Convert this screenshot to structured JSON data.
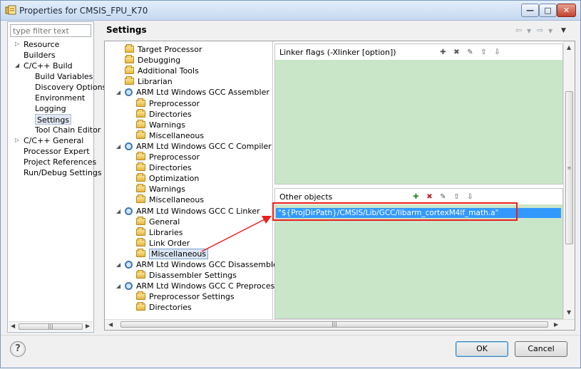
{
  "window": {
    "title": "Properties for CMSIS_FPU_K70"
  },
  "filter": {
    "placeholder": "type filter text"
  },
  "nav": [
    {
      "label": "Resource",
      "expandable": true
    },
    {
      "label": "Builders"
    },
    {
      "label": "C/C++ Build",
      "expanded": true
    },
    {
      "label": "Build Variables"
    },
    {
      "label": "Discovery Options"
    },
    {
      "label": "Environment"
    },
    {
      "label": "Logging"
    },
    {
      "label": "Settings",
      "selected": true
    },
    {
      "label": "Tool Chain Editor"
    },
    {
      "label": "C/C++ General",
      "expandable": true
    },
    {
      "label": "Processor Expert"
    },
    {
      "label": "Project References"
    },
    {
      "label": "Run/Debug Settings"
    }
  ],
  "settings": {
    "title": "Settings"
  },
  "tree": [
    {
      "label": "Target Processor",
      "icon": "folder-icon"
    },
    {
      "label": "Debugging",
      "icon": "folder-icon"
    },
    {
      "label": "Additional Tools",
      "icon": "folder-icon"
    },
    {
      "label": "Librarian",
      "icon": "folder-icon"
    },
    {
      "label": "ARM Ltd Windows GCC Assembler",
      "icon": "gear-icon"
    },
    {
      "label": "Preprocessor",
      "icon": "folder-icon"
    },
    {
      "label": "Directories",
      "icon": "folder-icon"
    },
    {
      "label": "Warnings",
      "icon": "folder-icon"
    },
    {
      "label": "Miscellaneous",
      "icon": "folder-icon"
    },
    {
      "label": "ARM Ltd Windows GCC C Compiler",
      "icon": "gear-icon"
    },
    {
      "label": "Preprocessor",
      "icon": "folder-icon"
    },
    {
      "label": "Directories",
      "icon": "folder-icon"
    },
    {
      "label": "Optimization",
      "icon": "folder-icon"
    },
    {
      "label": "Warnings",
      "icon": "folder-icon"
    },
    {
      "label": "Miscellaneous",
      "icon": "folder-icon"
    },
    {
      "label": "ARM Ltd Windows GCC C Linker",
      "icon": "gear-icon"
    },
    {
      "label": "General",
      "icon": "folder-icon"
    },
    {
      "label": "Libraries",
      "icon": "folder-icon"
    },
    {
      "label": "Link Order",
      "icon": "folder-icon"
    },
    {
      "label": "Miscellaneous",
      "icon": "folder-icon",
      "selected": true
    },
    {
      "label": "ARM Ltd Windows GCC Disassembler",
      "icon": "gear-icon"
    },
    {
      "label": "Disassembler Settings",
      "icon": "folder-icon"
    },
    {
      "label": "ARM Ltd Windows GCC C Preprocessor",
      "icon": "gear-icon"
    },
    {
      "label": "Preprocessor Settings",
      "icon": "folder-icon"
    },
    {
      "label": "Directories",
      "icon": "folder-icon"
    }
  ],
  "linker_flags": {
    "label": "Linker flags (-Xlinker [option])"
  },
  "other_objects": {
    "label": "Other objects",
    "items": [
      "\"${ProjDirPath}/CMSIS/Lib/GCC/libarm_cortexM4lf_math.a\""
    ]
  },
  "buttons": {
    "ok": "OK",
    "cancel": "Cancel",
    "help": "?"
  },
  "colors": {
    "pane_bg": "#cae6c9",
    "selection": "#3399ff",
    "annotation": "#ee1c1c"
  }
}
